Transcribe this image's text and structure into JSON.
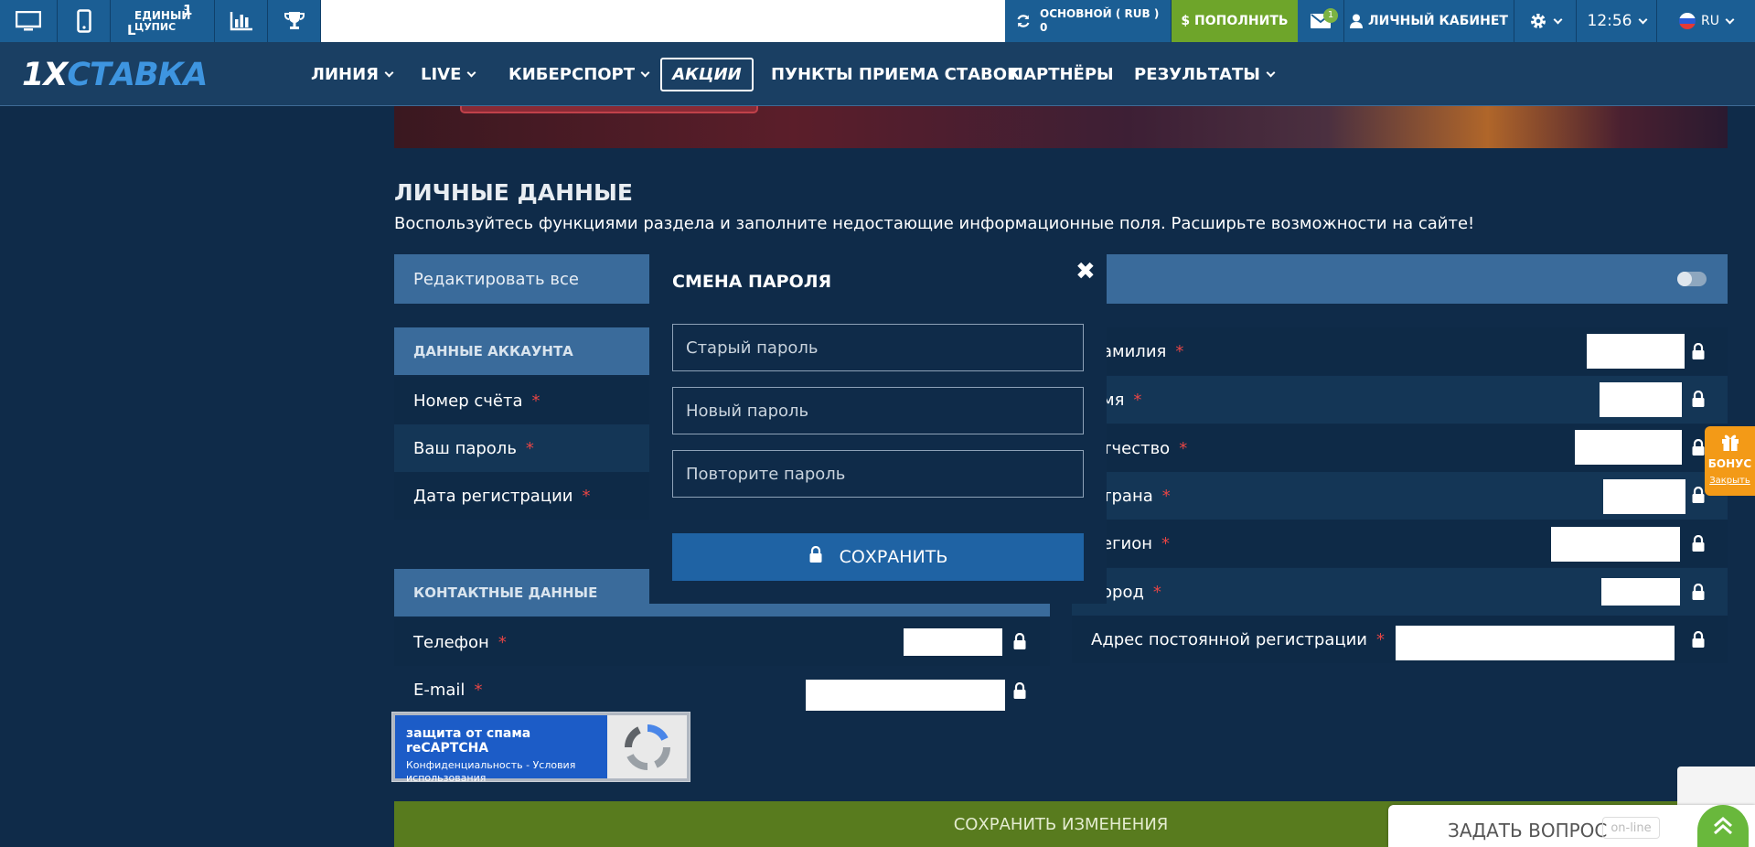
{
  "topbar": {
    "cupis_line1": "ЕДИНЫЙ",
    "cupis_line2": "ЦУПИС",
    "cupis_sup": "1",
    "cupis_l": "L",
    "balance_label": "ОСНОВНОЙ ( RUB )",
    "balance_value": "0",
    "deposit_label": "$ ПОПОЛНИТЬ",
    "mail_count": "1",
    "cabinet_label": "ЛИЧНЫЙ КАБИНЕТ",
    "time": "12:56",
    "lang": "RU"
  },
  "nav": {
    "logo_a": "1X",
    "logo_b": "СТАВКА",
    "items": [
      "ЛИНИЯ",
      "LIVE",
      "КИБЕРСПОРТ",
      "АКЦИИ",
      "ПУНКТЫ ПРИЕМА СТАВОК",
      "ПАРТНЁРЫ",
      "РЕЗУЛЬТАТЫ"
    ]
  },
  "page": {
    "title": "ЛИЧНЫЕ ДАННЫЕ",
    "description": "Воспользуйтесь функциями раздела и заполните недостающие информационные поля. Расширьте возможности на сайте!",
    "edit_all": "Редактировать все",
    "required_mark": "*"
  },
  "account": {
    "header": "ДАННЫЕ АККАУНТА",
    "rows": [
      "Номер счёта",
      "Ваш пароль",
      "Дата регистрации"
    ]
  },
  "contacts": {
    "header": "КОНТАКТНЫЕ ДАННЫЕ",
    "rows": [
      "Телефон",
      "E-mail"
    ]
  },
  "personal": {
    "rows": [
      "амилия",
      "мя",
      "тчество",
      "трана",
      "егион",
      "ород",
      "Адрес постоянной регистрации"
    ]
  },
  "modal": {
    "title": "СМЕНА ПАРОЛЯ",
    "close": "✖",
    "old_password": "Старый пароль",
    "new_password": "Новый пароль",
    "repeat_password": "Повторите пароль",
    "save": "СОХРАНИТЬ"
  },
  "recaptcha": {
    "title": "защита от спама reCAPTCHA",
    "links": "Конфиденциальность - Условия использования"
  },
  "footer": {
    "save_changes": "СОХРАНИТЬ ИЗМЕНЕНИЯ",
    "ask_question": "ЗАДАТЬ ВОПРОС",
    "online": "on-line"
  },
  "bonus": {
    "label": "БОНУС",
    "close": "Закрыть"
  },
  "colors": {
    "background": "#0f2b49",
    "topbar_blue": "#1b5e94",
    "deposit_green": "#6ea52a",
    "section_blue": "#3a6b9b",
    "save_green": "#587b1e",
    "bonus_orange": "#f39a17",
    "required_red": "#e64545"
  },
  "icons": [
    "desktop-icon",
    "mobile-icon",
    "stats-icon",
    "trophy-icon",
    "refresh-icon",
    "mail-icon",
    "user-icon",
    "gear-icon",
    "flag-ru-icon",
    "lock-icon",
    "gift-icon",
    "chevron-up-icon",
    "close-icon",
    "recaptcha-icon"
  ]
}
